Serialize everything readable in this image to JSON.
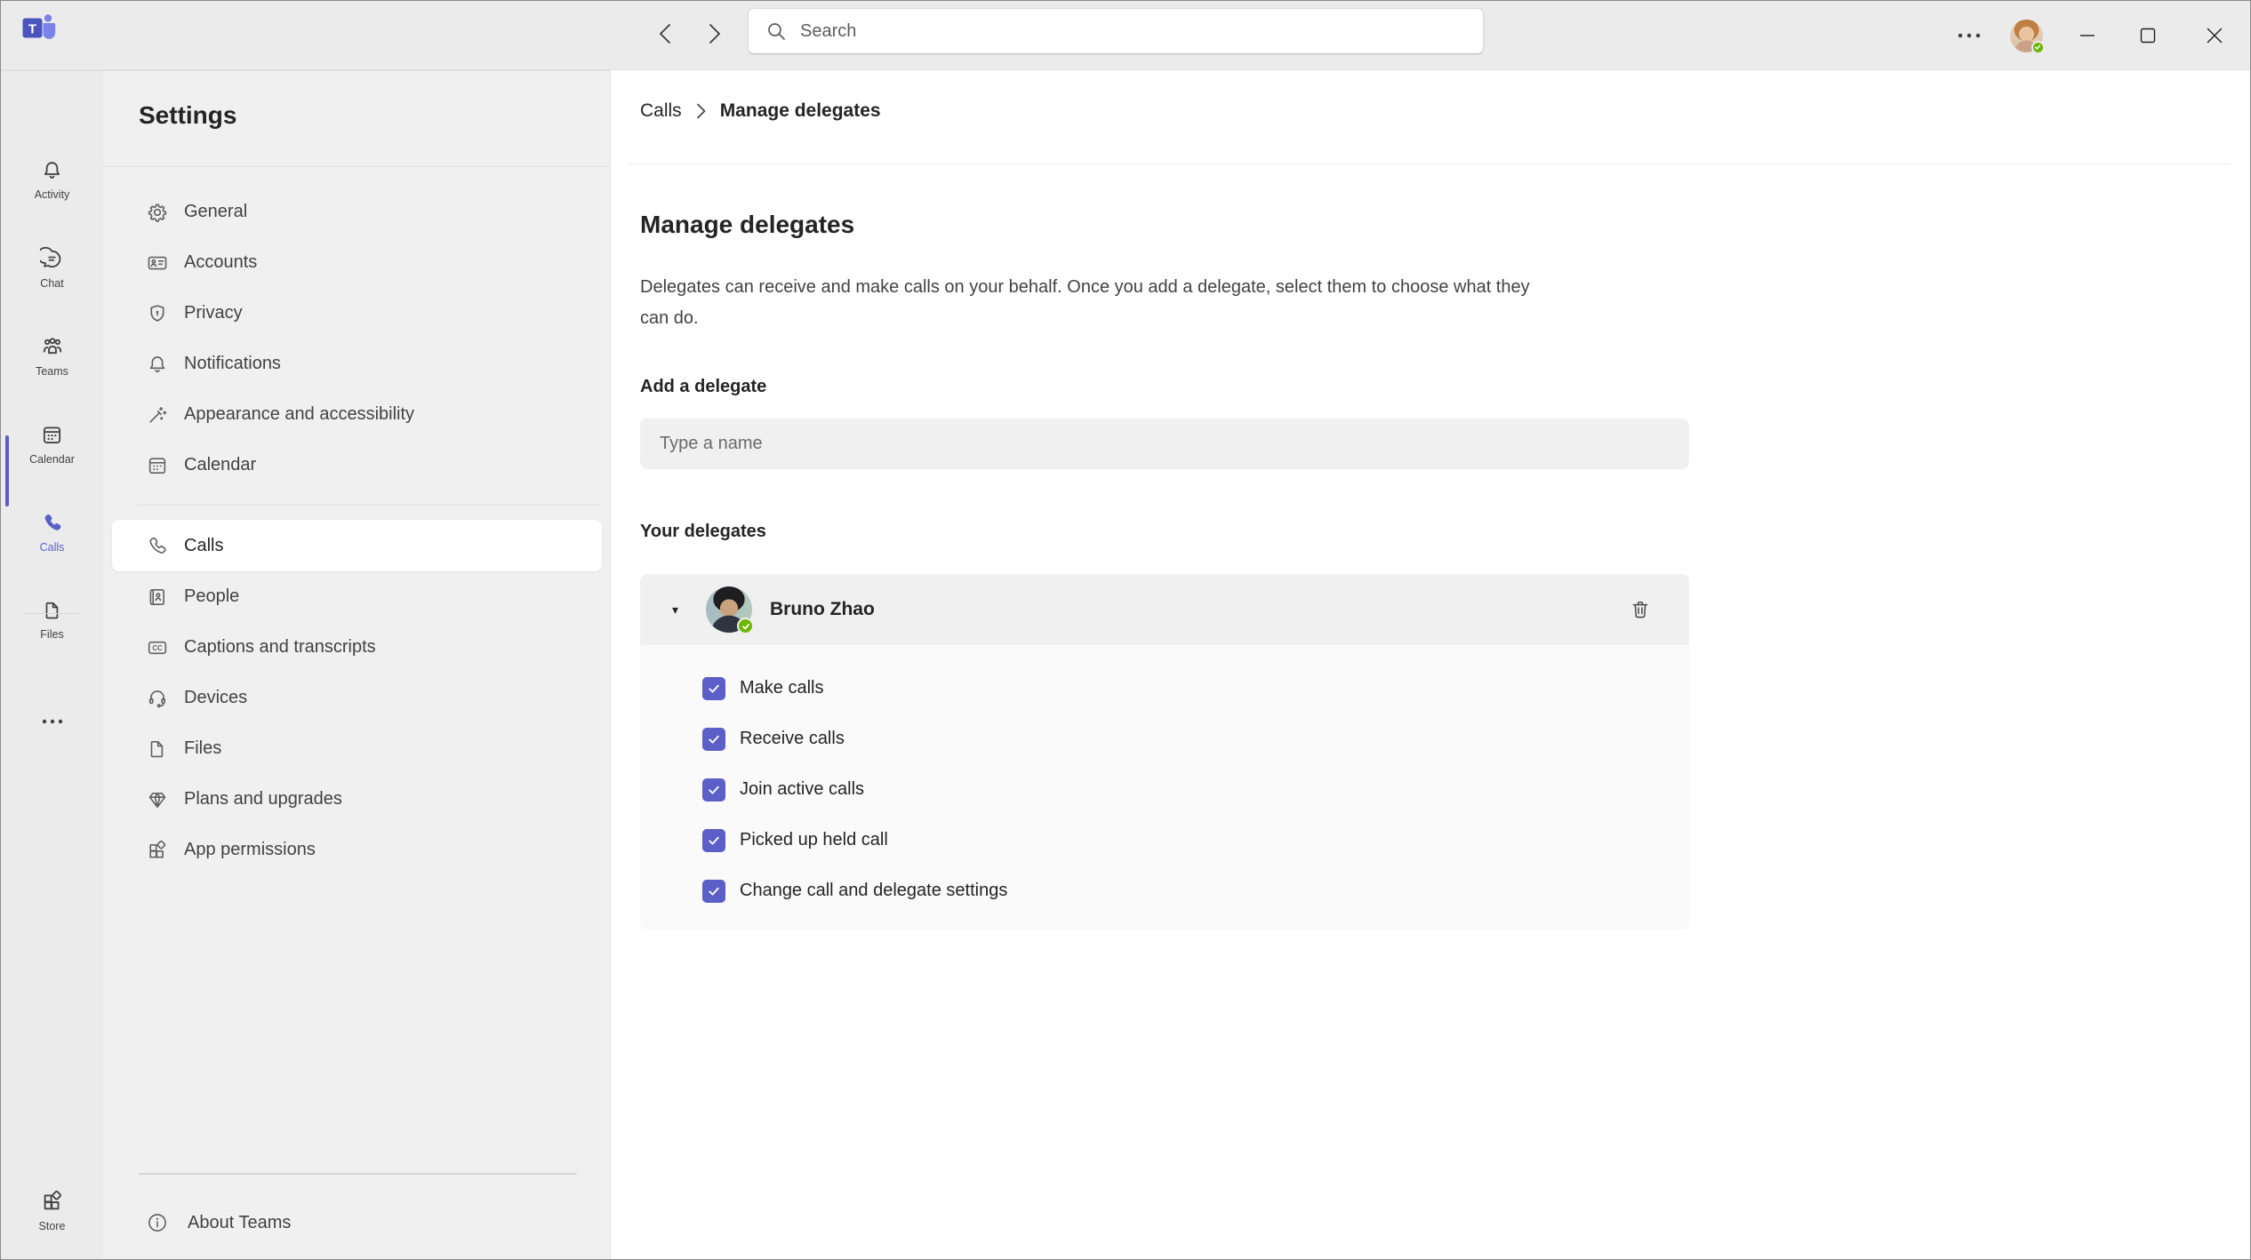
{
  "titlebar": {
    "search_placeholder": "Search",
    "icons": {
      "logo": "teams-logo",
      "back": "chevron-left-icon",
      "forward": "chevron-right-icon",
      "search": "search-icon",
      "more": "ellipsis-icon",
      "minimize": "minimize-icon",
      "maximize": "maximize-icon",
      "close": "close-icon"
    }
  },
  "rail": {
    "items": [
      {
        "label": "Activity",
        "icon": "bell-icon",
        "active": false
      },
      {
        "label": "Chat",
        "icon": "chat-bubble-icon",
        "active": false
      },
      {
        "label": "Teams",
        "icon": "people-group-icon",
        "active": false
      },
      {
        "label": "Calendar",
        "icon": "calendar-icon",
        "active": false
      },
      {
        "label": "Calls",
        "icon": "phone-icon",
        "active": true
      },
      {
        "label": "Files",
        "icon": "document-icon",
        "active": false
      }
    ],
    "more_icon": "ellipsis-icon",
    "store": {
      "label": "Store",
      "icon": "store-icon"
    }
  },
  "sidebar": {
    "title": "Settings",
    "nav1": [
      {
        "label": "General",
        "icon": "gear-icon"
      },
      {
        "label": "Accounts",
        "icon": "id-card-icon"
      },
      {
        "label": "Privacy",
        "icon": "shield-lock-icon"
      },
      {
        "label": "Notifications",
        "icon": "bell-icon"
      },
      {
        "label": "Appearance and accessibility",
        "icon": "wand-icon"
      },
      {
        "label": "Calendar",
        "icon": "calendar-icon"
      }
    ],
    "nav2": [
      {
        "label": "Calls",
        "icon": "phone-icon",
        "selected": true
      },
      {
        "label": "People",
        "icon": "contact-book-icon"
      },
      {
        "label": "Captions and transcripts",
        "icon": "closed-captions-icon"
      },
      {
        "label": "Devices",
        "icon": "headset-icon"
      },
      {
        "label": "Files",
        "icon": "document-icon"
      },
      {
        "label": "Plans and upgrades",
        "icon": "diamond-icon"
      },
      {
        "label": "App permissions",
        "icon": "app-grid-icon"
      }
    ],
    "about_label": "About Teams",
    "about_icon": "info-circle-icon"
  },
  "content": {
    "breadcrumb": {
      "parent": "Calls",
      "current": "Manage delegates"
    },
    "heading": "Manage delegates",
    "description": "Delegates can receive and make calls on your behalf. Once you add a delegate, select them to choose what they can do.",
    "add_delegate": {
      "label": "Add a delegate",
      "placeholder": "Type a name"
    },
    "your_delegates_label": "Your delegates",
    "delegate": {
      "name": "Bruno Zhao",
      "expanded": true,
      "presence": "available",
      "delete_icon": "trash-icon",
      "permissions": [
        {
          "label": "Make calls",
          "checked": true
        },
        {
          "label": "Receive calls",
          "checked": true
        },
        {
          "label": "Join active calls",
          "checked": true
        },
        {
          "label": "Picked up held call",
          "checked": true
        },
        {
          "label": "Change call and delegate settings",
          "checked": true
        }
      ]
    }
  },
  "colors": {
    "accent": "#5B5FC7",
    "presence_available": "#6BB700",
    "titlebar_bg": "#ebebeb",
    "sidebar_bg": "#f0f0f0",
    "card_header_bg": "#f0f0f0",
    "card_body_bg": "#fafafa"
  }
}
